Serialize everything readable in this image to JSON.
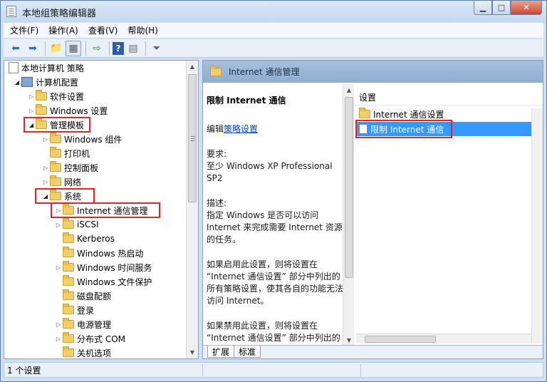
{
  "window": {
    "title": "本地组策略编辑器"
  },
  "menu": [
    "文件(F)",
    "操作(A)",
    "查看(V)",
    "帮助(H)"
  ],
  "toolbar": {
    "icons": [
      "back-icon",
      "forward-icon",
      "up-folder-icon",
      "show-hide-tree-icon",
      "export-list-icon",
      "help-icon",
      "properties-icon",
      "filter-icon"
    ]
  },
  "tree": {
    "root": "本地计算机 策略",
    "computer_config": "计算机配置",
    "software_settings": "软件设置",
    "windows_settings": "Windows 设置",
    "admin_templates": "管理模板",
    "windows_components": "Windows 组件",
    "printers": "打印机",
    "control_panel": "控制面板",
    "network": "网络",
    "system": "系统",
    "internet_comm": "Internet 通信管理",
    "iscsi": "iSCSI",
    "kerberos": "Kerberos",
    "hot_start": "Windows 热启动",
    "time_service": "Windows 时间服务",
    "file_protection": "Windows 文件保护",
    "disk_quota": "磁盘配额",
    "logon": "登录",
    "power": "电源管理",
    "dcom": "分布式 COM",
    "shutdown": "关机选项"
  },
  "right": {
    "header_title": "Internet 通信管理",
    "desc_heading": "限制 Internet 通信",
    "edit_prefix": "编辑",
    "edit_link": "策略设置",
    "req_label": "要求:",
    "req_value": "至少 Windows XP Professional SP2",
    "desc_label": "描述:",
    "desc_text": "指定 Windows 是否可以访问 Internet 来完成需要 Internet 资源的任务。",
    "enabled_text": "如果启用此设置，则将设置在 “Internet 通信设置” 部分中列出的所有策略设置，使其各自的功能无法访问 Internet。",
    "disabled_text": "如果禁用此设置，则将设置在 “Internet 通信设置” 部分中列出的所有策略设置，以便其各自的功能可以访问 Internet。",
    "list_header": "设置",
    "list_items": [
      "Internet 通信设置",
      "限制 Internet 通信"
    ],
    "tabs": [
      "扩展",
      "标准"
    ]
  },
  "status": {
    "text": "1 个设置"
  },
  "colors": {
    "selection": "#3399ff",
    "highlight_box": "#e2232a",
    "header": "#8fadd1"
  }
}
